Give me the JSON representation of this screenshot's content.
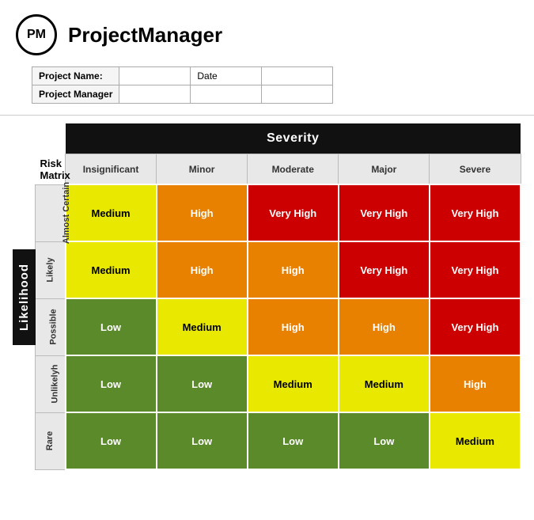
{
  "header": {
    "logo_text": "PM",
    "app_title": "ProjectManager"
  },
  "project_info": {
    "label_name": "Project Name:",
    "label_manager": "Project Manager",
    "label_date": "Date"
  },
  "matrix": {
    "severity_label": "Severity",
    "likelihood_label": "Likelihood",
    "risk_matrix_label": "Risk Matrix",
    "col_headers": [
      "Insignificant",
      "Minor",
      "Moderate",
      "Major",
      "Severe"
    ],
    "rows": [
      {
        "label": "Almost Certain",
        "cells": [
          {
            "text": "Medium",
            "class": "cell-medium"
          },
          {
            "text": "High",
            "class": "cell-high"
          },
          {
            "text": "Very High",
            "class": "cell-very-high"
          },
          {
            "text": "Very High",
            "class": "cell-very-high"
          },
          {
            "text": "Very High",
            "class": "cell-very-high"
          }
        ]
      },
      {
        "label": "Likely",
        "cells": [
          {
            "text": "Medium",
            "class": "cell-medium"
          },
          {
            "text": "High",
            "class": "cell-high"
          },
          {
            "text": "High",
            "class": "cell-high"
          },
          {
            "text": "Very High",
            "class": "cell-very-high"
          },
          {
            "text": "Very High",
            "class": "cell-very-high"
          }
        ]
      },
      {
        "label": "Possible",
        "cells": [
          {
            "text": "Low",
            "class": "cell-low"
          },
          {
            "text": "Medium",
            "class": "cell-medium"
          },
          {
            "text": "High",
            "class": "cell-high"
          },
          {
            "text": "High",
            "class": "cell-high"
          },
          {
            "text": "Very High",
            "class": "cell-very-high"
          }
        ]
      },
      {
        "label": "Unlikelyh",
        "cells": [
          {
            "text": "Low",
            "class": "cell-low"
          },
          {
            "text": "Low",
            "class": "cell-low"
          },
          {
            "text": "Medium",
            "class": "cell-medium"
          },
          {
            "text": "Medium",
            "class": "cell-medium"
          },
          {
            "text": "High",
            "class": "cell-high"
          }
        ]
      },
      {
        "label": "Rare",
        "cells": [
          {
            "text": "Low",
            "class": "cell-low"
          },
          {
            "text": "Low",
            "class": "cell-low"
          },
          {
            "text": "Low",
            "class": "cell-low"
          },
          {
            "text": "Low",
            "class": "cell-low"
          },
          {
            "text": "Medium",
            "class": "cell-medium"
          }
        ]
      }
    ]
  }
}
